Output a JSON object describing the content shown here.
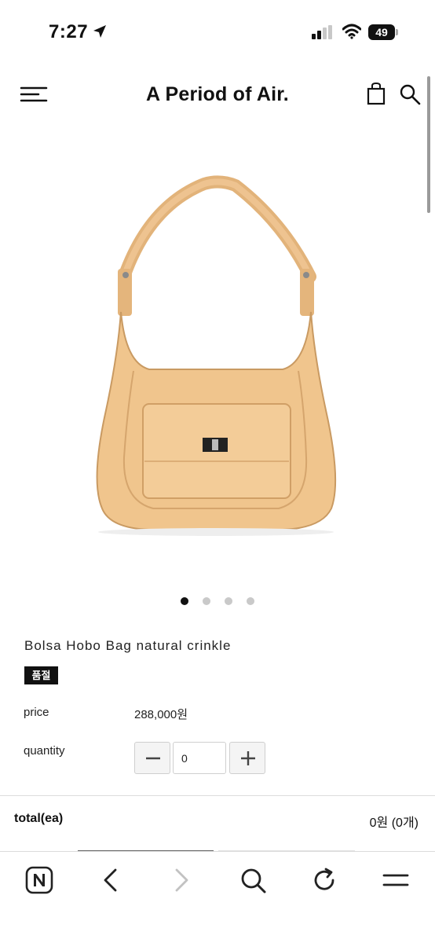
{
  "status_bar": {
    "time": "7:27",
    "battery": "49"
  },
  "header": {
    "brand": "A Period of Air."
  },
  "product": {
    "name": "Bolsa Hobo Bag natural crinkle",
    "badge": "품절",
    "price_label": "price",
    "price_value": "288,000원",
    "quantity_label": "quantity",
    "quantity_value": "0",
    "image_count": 4,
    "active_image": 1
  },
  "total": {
    "label": "total(ea)",
    "value": "0원 (0개)"
  },
  "icons": [
    "location-arrow-icon",
    "signal-icon",
    "wifi-icon",
    "battery-icon",
    "menu-icon",
    "cart-icon",
    "search-icon",
    "minus-icon",
    "plus-icon",
    "naver-icon",
    "back-icon",
    "forward-icon",
    "search-icon",
    "refresh-icon",
    "menu-icon"
  ]
}
